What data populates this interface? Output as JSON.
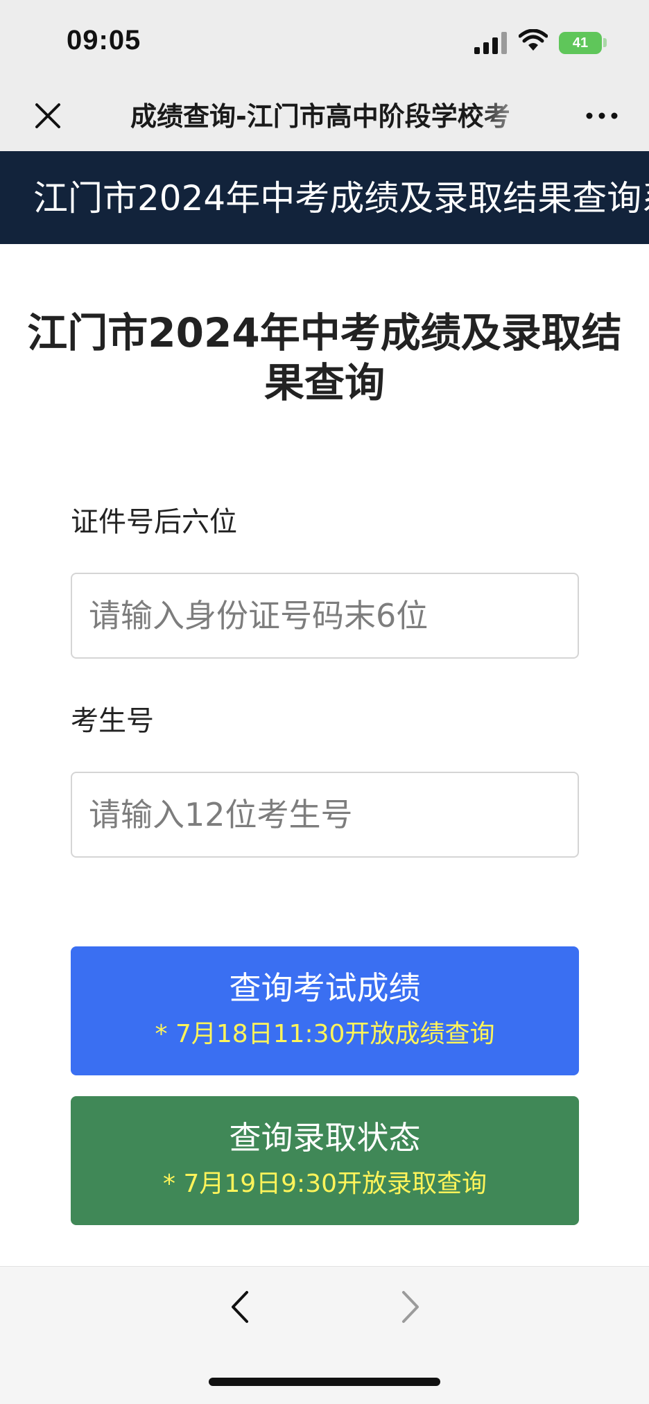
{
  "status_bar": {
    "time": "09:05",
    "battery": "41",
    "icons": [
      "signal-icon",
      "wifi-icon",
      "battery-icon"
    ]
  },
  "nav": {
    "title": "成绩查询-江门市高中阶段学校考",
    "icons": [
      "close-icon",
      "more-icon"
    ]
  },
  "banner": {
    "text": "江门市2024年中考成绩及录取结果查询系"
  },
  "page": {
    "title": "江门市2024年中考成绩及录取结果查询"
  },
  "form": {
    "id_label": "证件号后六位",
    "id_placeholder": "请输入身份证号码末6位",
    "id_value": "",
    "exam_label": "考生号",
    "exam_placeholder": "请输入12位考生号",
    "exam_value": ""
  },
  "buttons": {
    "score": {
      "label": "查询考试成绩",
      "note": "* 7月18日11:30开放成绩查询",
      "color": "#3a6ff2"
    },
    "admission": {
      "label": "查询录取状态",
      "note": "* 7月19日9:30开放录取查询",
      "color": "#408857"
    }
  },
  "bottom_nav": {
    "icons": [
      "chevron-left-icon",
      "chevron-right-icon"
    ]
  },
  "colors": {
    "banner_bg": "#12233b",
    "note_text": "#fff45a",
    "battery": "#5fc65a"
  }
}
